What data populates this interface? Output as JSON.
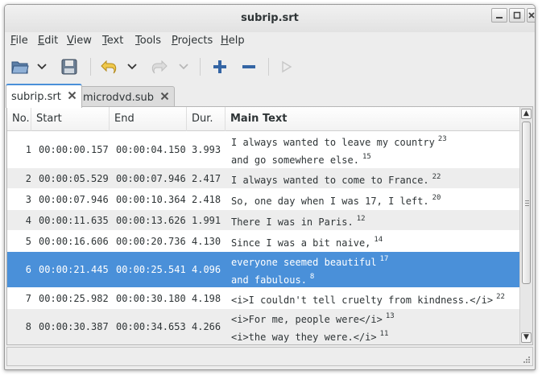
{
  "window": {
    "title": "subrip.srt"
  },
  "menu": [
    "File",
    "Edit",
    "View",
    "Text",
    "Tools",
    "Projects",
    "Help"
  ],
  "tabs": [
    {
      "label": "subrip.srt",
      "active": true
    },
    {
      "label": "microdvd.sub",
      "active": false
    }
  ],
  "columns": {
    "no": "No.",
    "start": "Start",
    "end": "End",
    "dur": "Dur.",
    "main": "Main Text"
  },
  "rows": [
    {
      "no": "1",
      "start": "00:00:00.157",
      "end": "00:00:04.150",
      "dur": "3.993",
      "lines": [
        {
          "text": "I always wanted to leave my country",
          "n": "23"
        },
        {
          "text": "and go somewhere else.",
          "n": "15"
        }
      ]
    },
    {
      "no": "2",
      "start": "00:00:05.529",
      "end": "00:00:07.946",
      "dur": "2.417",
      "lines": [
        {
          "text": "I always wanted to come to France.",
          "n": "22"
        }
      ]
    },
    {
      "no": "3",
      "start": "00:00:07.946",
      "end": "00:00:10.364",
      "dur": "2.418",
      "lines": [
        {
          "text": "So, one day when I was 17, I left.",
          "n": "20"
        }
      ]
    },
    {
      "no": "4",
      "start": "00:00:11.635",
      "end": "00:00:13.626",
      "dur": "1.991",
      "lines": [
        {
          "text": "There I was in Paris.",
          "n": "12"
        }
      ]
    },
    {
      "no": "5",
      "start": "00:00:16.606",
      "end": "00:00:20.736",
      "dur": "4.130",
      "lines": [
        {
          "text": "Since I was a bit naive,",
          "n": "14"
        }
      ]
    },
    {
      "no": "6",
      "start": "00:00:21.445",
      "end": "00:00:25.541",
      "dur": "4.096",
      "selected": true,
      "lines": [
        {
          "text": "everyone seemed beautiful",
          "n": "17"
        },
        {
          "text": "and fabulous.",
          "n": "8"
        }
      ]
    },
    {
      "no": "7",
      "start": "00:00:25.982",
      "end": "00:00:30.180",
      "dur": "4.198",
      "lines": [
        {
          "text": "<i>I couldn't tell cruelty from kindness.</i>",
          "n": "22"
        }
      ]
    },
    {
      "no": "8",
      "start": "00:00:30.387",
      "end": "00:00:34.653",
      "dur": "4.266",
      "lines": [
        {
          "text": "<i>For me, people were</i>",
          "n": "13"
        },
        {
          "text": "<i>the way they were.</i>",
          "n": "11"
        }
      ]
    }
  ],
  "icons": {
    "open": "folder-open-icon",
    "save": "save-icon",
    "undo": "undo-icon",
    "redo": "redo-icon",
    "add": "insert-subtitle-icon",
    "remove": "remove-subtitle-icon",
    "play": "play-icon"
  },
  "colors": {
    "selection": "#4a90d9",
    "row_alt": "#ededed",
    "accent_blue": "#3465a4"
  }
}
